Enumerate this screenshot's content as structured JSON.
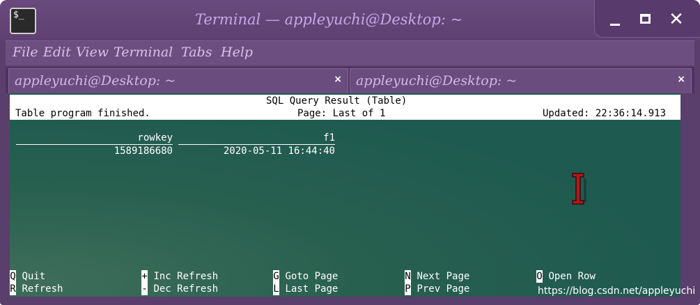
{
  "window": {
    "icon_text": "$_",
    "title": "Terminal — appleyuchi@Desktop: ~",
    "controls": {
      "minimize": "minimize-icon",
      "maximize": "maximize-icon",
      "close": "✕"
    }
  },
  "menu": [
    "File",
    "Edit",
    "View",
    "Terminal",
    "Tabs",
    "Help"
  ],
  "tabs": [
    {
      "label": "appleyuchi@Desktop: ~",
      "close": "×"
    },
    {
      "label": "appleyuchi@Desktop: ~",
      "close": "×"
    }
  ],
  "terminal": {
    "header": {
      "title": "SQL Query Result (Table)",
      "status": "Table program finished.",
      "page": "Page: Last of 1",
      "updated": "Updated: 22:36:14.913"
    },
    "table": {
      "columns": [
        "rowkey",
        "f1"
      ],
      "rows": [
        [
          "1589186680",
          "2020-05-11 16:44:40"
        ]
      ]
    },
    "footer": [
      [
        {
          "key": "Q",
          "label": "Quit"
        },
        {
          "key": "R",
          "label": "Refresh"
        }
      ],
      [
        {
          "key": "+",
          "label": "Inc Refresh"
        },
        {
          "key": "-",
          "label": "Dec Refresh"
        }
      ],
      [
        {
          "key": "G",
          "label": "Goto Page"
        },
        {
          "key": "L",
          "label": "Last Page"
        }
      ],
      [
        {
          "key": "N",
          "label": "Next Page"
        },
        {
          "key": "P",
          "label": "Prev Page"
        }
      ],
      [
        {
          "key": "O",
          "label": "Open Row"
        }
      ]
    ]
  },
  "watermark": "https://blog.csdn.net/appleyuchi",
  "colors": {
    "window_bg": "#5a3e6b",
    "title_text": "#c9a6e6",
    "terminal_bg": "#1f5a50",
    "cursor": "#b01818"
  }
}
